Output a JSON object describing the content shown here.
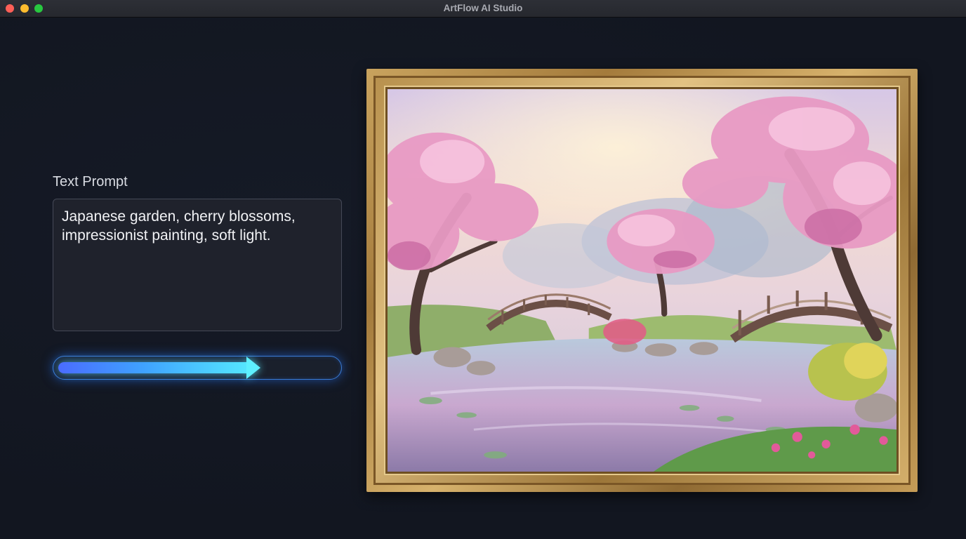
{
  "window": {
    "title": "ArtFlow AI Studio"
  },
  "prompt": {
    "label": "Text Prompt",
    "value": "Japanese garden, cherry blossoms,\nimpressionist painting, soft light."
  },
  "progress": {
    "percent": 73
  },
  "artwork": {
    "subject": "painting-icon"
  },
  "colors": {
    "accent": "#3fa2ff",
    "glow": "#54e6ff",
    "background": "#131722"
  }
}
